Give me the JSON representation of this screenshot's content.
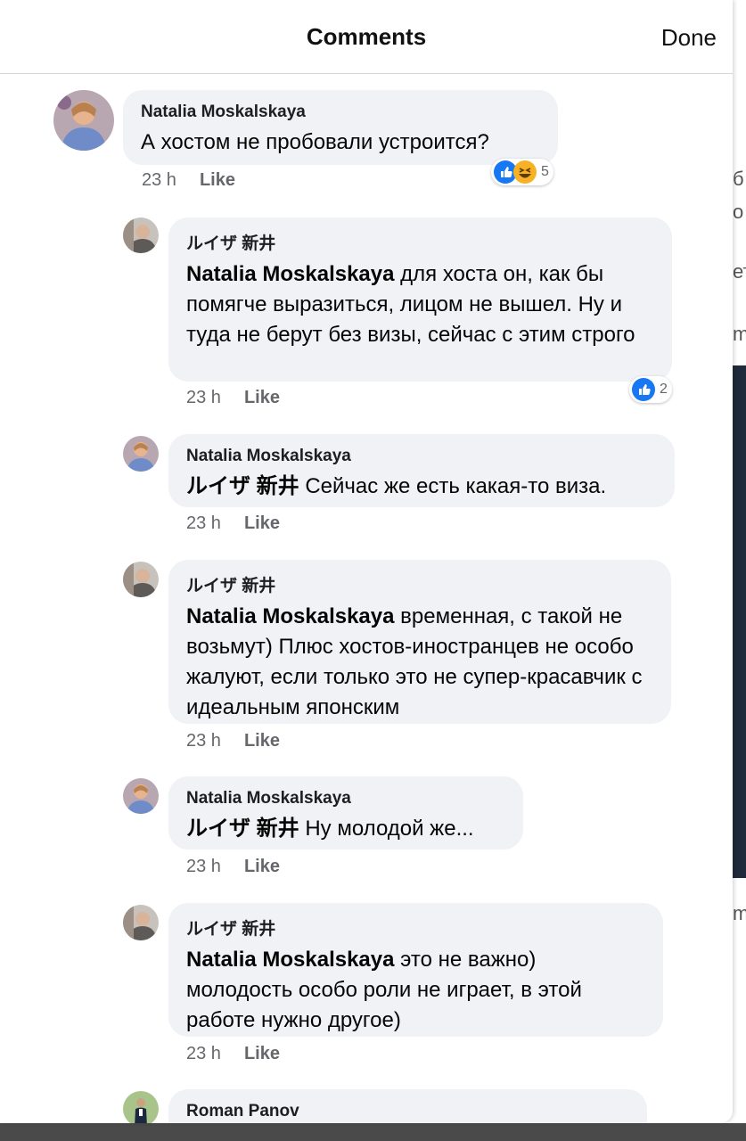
{
  "header": {
    "title": "Comments",
    "done_label": "Done"
  },
  "background_fragments": [
    "б",
    "о",
    "ет",
    "m",
    "m"
  ],
  "comments": [
    {
      "author": "Natalia Moskalskaya",
      "mention": "",
      "text": "А хостом не пробовали устроится?",
      "time": "23 h",
      "like": "Like",
      "reaction_count": "5"
    },
    {
      "author": "ルイザ 新井",
      "mention": "Natalia Moskalskaya",
      "text": "для хоста он, как бы помягче выразиться, лицом не вышел. Ну и туда не берут без визы, сейчас с этим строго",
      "time": "23 h",
      "like": "Like",
      "reaction_count": "2"
    },
    {
      "author": "Natalia Moskalskaya",
      "mention": "ルイザ 新井",
      "text": "Сейчас же есть какая-то виза.",
      "time": "23 h",
      "like": "Like"
    },
    {
      "author": "ルイザ 新井",
      "mention": "Natalia Moskalskaya",
      "text": "временная, с такой не возьмут) Плюс хостов-иностранцев не особо жалуют, если только это не супер-красавчик с идеальным японским",
      "time": "23 h",
      "like": "Like"
    },
    {
      "author": "Natalia Moskalskaya",
      "mention": "ルイザ 新井",
      "text": "Ну молодой же...",
      "time": "23 h",
      "like": "Like"
    },
    {
      "author": "ルイザ 新井",
      "mention": "Natalia Moskalskaya",
      "text": "это не важно) молодость особо роли не играет, в этой работе нужно другое)",
      "time": "23 h",
      "like": "Like"
    },
    {
      "author": "Roman Panov"
    }
  ],
  "colors": {
    "like_blue": "#1877f2",
    "haha_yellow": "#f7b125",
    "bubble_bg": "#f0f2f5",
    "meta_gray": "#65676b"
  }
}
